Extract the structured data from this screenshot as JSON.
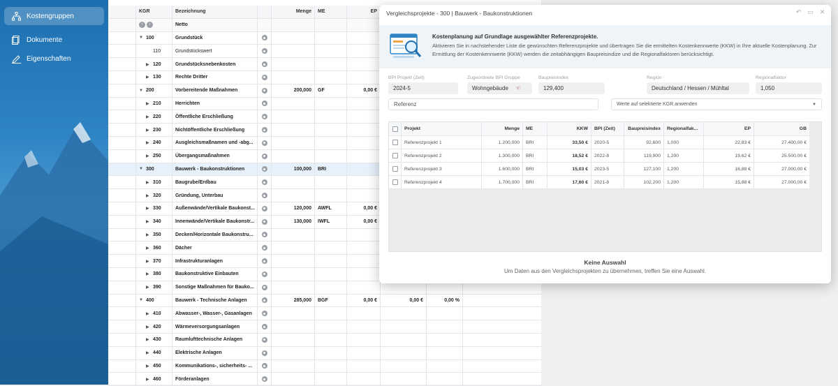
{
  "sidebar": {
    "items": [
      {
        "label": "Kostengruppen",
        "icon": "hierarchy-icon",
        "active": true
      },
      {
        "label": "Dokumente",
        "icon": "document-icon",
        "active": false
      },
      {
        "label": "Eigenschaften",
        "icon": "pencil-icon",
        "active": false
      }
    ]
  },
  "grid": {
    "headers": {
      "kgr": "KGR",
      "bezeichnung": "Bezeichnung",
      "menge": "Menge",
      "me": "ME",
      "ep": "EP"
    },
    "netto_label": "Netto",
    "rows": [
      {
        "expand": "down",
        "kgr": "100",
        "label": "Grundstück",
        "bold": true,
        "menge": "",
        "me": "",
        "ep": "",
        "col8": "",
        "pct": ""
      },
      {
        "expand": "",
        "kgr": "110",
        "label": "Grundstückswert",
        "bold": false,
        "menge": "",
        "me": "",
        "ep": "",
        "col8": "",
        "pct": ""
      },
      {
        "expand": "right",
        "kgr": "120",
        "label": "Grundstücksnebenkosten",
        "bold": true,
        "menge": "",
        "me": "",
        "ep": "",
        "col8": "",
        "pct": ""
      },
      {
        "expand": "right",
        "kgr": "130",
        "label": "Rechte Dritter",
        "bold": true,
        "menge": "",
        "me": "",
        "ep": "",
        "col8": "",
        "pct": ""
      },
      {
        "expand": "down",
        "kgr": "200",
        "label": "Vorbereitende Maßnahmen",
        "bold": true,
        "menge": "200,000",
        "me": "GF",
        "ep": "0,00 €",
        "col8": "",
        "pct": ""
      },
      {
        "expand": "right",
        "kgr": "210",
        "label": "Herrichten",
        "bold": true,
        "menge": "",
        "me": "",
        "ep": "",
        "col8": "",
        "pct": ""
      },
      {
        "expand": "right",
        "kgr": "220",
        "label": "Öffentliche Erschließung",
        "bold": true,
        "menge": "",
        "me": "",
        "ep": "",
        "col8": "",
        "pct": ""
      },
      {
        "expand": "right",
        "kgr": "230",
        "label": "Nichtöffentliche Erschließung",
        "bold": true,
        "menge": "",
        "me": "",
        "ep": "",
        "col8": "",
        "pct": ""
      },
      {
        "expand": "right",
        "kgr": "240",
        "label": "Ausgleichsmaßnamen und -abg...",
        "bold": true,
        "menge": "",
        "me": "",
        "ep": "",
        "col8": "",
        "pct": ""
      },
      {
        "expand": "right",
        "kgr": "250",
        "label": "Übergangsmaßnahmen",
        "bold": true,
        "menge": "",
        "me": "",
        "ep": "",
        "col8": "",
        "pct": ""
      },
      {
        "expand": "down",
        "kgr": "300",
        "label": "Bauwerk - Baukonstruktionen",
        "bold": true,
        "selected": true,
        "menge": "100,000",
        "me": "BRI",
        "ep": "",
        "col8": "",
        "pct": ""
      },
      {
        "expand": "right",
        "kgr": "310",
        "label": "Baugrube/Erdbau",
        "bold": true,
        "menge": "",
        "me": "",
        "ep": "",
        "col8": "",
        "pct": ""
      },
      {
        "expand": "right",
        "kgr": "320",
        "label": "Gründung, Unterbau",
        "bold": true,
        "menge": "",
        "me": "",
        "ep": "",
        "col8": "",
        "pct": ""
      },
      {
        "expand": "right",
        "kgr": "330",
        "label": "Außenwände/Vertikale Baukonst...",
        "bold": true,
        "menge": "120,000",
        "me": "AWFL",
        "ep": "0,00 €",
        "col8": "",
        "pct": ""
      },
      {
        "expand": "right",
        "kgr": "340",
        "label": "Innenwände/Vertikale Baukonstr...",
        "bold": true,
        "menge": "130,000",
        "me": "IWFL",
        "ep": "0,00 €",
        "col8": "",
        "pct": ""
      },
      {
        "expand": "right",
        "kgr": "350",
        "label": "Decken/Horizontale Baukonstru...",
        "bold": true,
        "menge": "",
        "me": "",
        "ep": "",
        "col8": "",
        "pct": ""
      },
      {
        "expand": "right",
        "kgr": "360",
        "label": "Dächer",
        "bold": true,
        "menge": "",
        "me": "",
        "ep": "",
        "col8": "",
        "pct": ""
      },
      {
        "expand": "right",
        "kgr": "370",
        "label": "Infrastrukturanlagen",
        "bold": true,
        "menge": "",
        "me": "",
        "ep": "",
        "col8": "",
        "pct": ""
      },
      {
        "expand": "right",
        "kgr": "380",
        "label": "Baukonstruktive Einbauten",
        "bold": true,
        "menge": "",
        "me": "",
        "ep": "",
        "col8": "",
        "pct": ""
      },
      {
        "expand": "right",
        "kgr": "390",
        "label": "Sonstige Maßnahmen für Bauko...",
        "bold": true,
        "menge": "",
        "me": "",
        "ep": "",
        "col8": "",
        "pct": ""
      },
      {
        "expand": "down",
        "kgr": "400",
        "label": "Bauwerk - Technische Anlagen",
        "bold": true,
        "menge": "285,000",
        "me": "BGF",
        "ep": "0,00 €",
        "col8": "0,00 €",
        "pct": "0,00 %"
      },
      {
        "expand": "right",
        "kgr": "410",
        "label": "Abwasser-, Wasser-, Gasanlagen",
        "bold": true,
        "menge": "",
        "me": "",
        "ep": "",
        "col8": "",
        "pct": ""
      },
      {
        "expand": "right",
        "kgr": "420",
        "label": "Wärmeversorgungsanlagen",
        "bold": true,
        "menge": "",
        "me": "",
        "ep": "",
        "col8": "",
        "pct": ""
      },
      {
        "expand": "right",
        "kgr": "430",
        "label": "Raumlufttechnische Anlagen",
        "bold": true,
        "menge": "",
        "me": "",
        "ep": "",
        "col8": "",
        "pct": ""
      },
      {
        "expand": "right",
        "kgr": "440",
        "label": "Elektrische Anlagen",
        "bold": true,
        "menge": "",
        "me": "",
        "ep": "",
        "col8": "",
        "pct": ""
      },
      {
        "expand": "right",
        "kgr": "450",
        "label": "Kommunikations-, sicherheits- ...",
        "bold": true,
        "menge": "",
        "me": "",
        "ep": "",
        "col8": "",
        "pct": ""
      },
      {
        "expand": "right",
        "kgr": "460",
        "label": "Förderanlagen",
        "bold": true,
        "menge": "",
        "me": "",
        "ep": "",
        "col8": "",
        "pct": ""
      }
    ]
  },
  "dialog": {
    "title": "Vergleichsprojekte - 300 | Bauwerk - Baukonstruktionen",
    "info_title": "Kostenplanung auf Grundlage ausgewählter Referenzprojekte.",
    "info_text": "Aktivieren Sie in nachstehender Liste die gewünschten Referenzprojekte und übertragen Sie die ermittelten Kostenkennwerte (KKW) in Ihre aktuelle Kostenplanung. Zur Ermittlung der Kostenkennwerte (KKW) werden die zeitabhängigen Baupreisindize und die Regionalfaktoren berücksichtigt.",
    "fields": {
      "bpi_projekt_label": "BPI Projekt (Zeit)",
      "bpi_projekt_value": "2024-5",
      "bpi_gruppe_label": "Zugeordnete BPI Gruppe",
      "bpi_gruppe_value": "Wohngebäude",
      "baupreisindex_label": "Baupreisindex",
      "baupreisindex_value": "129,400",
      "region_label": "Region",
      "region_value": "Deutschland / Hessen / Mühltal",
      "regionalfaktor_label": "Regionalfaktor",
      "regionalfaktor_value": "1,050"
    },
    "referenz_placeholder": "Referenz",
    "apply_select": "Werte auf selektierte KGR anwenden",
    "table": {
      "headers": {
        "projekt": "Projekt",
        "menge": "Menge",
        "me": "ME",
        "kkw": "KKW",
        "bpi": "BPI (Zeit)",
        "baupreisindex": "Baupreisindex",
        "regionalfaktor": "Regionalfak...",
        "ep": "EP",
        "gb": "GB"
      },
      "rows": [
        {
          "projekt": "Referenzprojekt 1",
          "menge": "1.200,000",
          "me": "BRI",
          "kkw": "33,50 €",
          "bpi": "2020-5",
          "baupreisindex": "92,600",
          "regionalfaktor": "1,000",
          "ep": "22,83 €",
          "gb": "27.400,00 €"
        },
        {
          "projekt": "Referenzprojekt 2",
          "menge": "1.300,000",
          "me": "BRI",
          "kkw": "18,52 €",
          "bpi": "2022-8",
          "baupreisindex": "119,900",
          "regionalfaktor": "1,200",
          "ep": "19,62 €",
          "gb": "25.500,00 €"
        },
        {
          "projekt": "Referenzprojekt 3",
          "menge": "1.600,000",
          "me": "BRI",
          "kkw": "15,03 €",
          "bpi": "2023-5",
          "baupreisindex": "127,100",
          "regionalfaktor": "1,200",
          "ep": "16,88 €",
          "gb": "27.000,00 €"
        },
        {
          "projekt": "Referenzprojekt 4",
          "menge": "1.700,000",
          "me": "BRI",
          "kkw": "17,60 €",
          "bpi": "2021-8",
          "baupreisindex": "102,200",
          "regionalfaktor": "1,200",
          "ep": "15,88 €",
          "gb": "27.000,00 €"
        }
      ]
    },
    "empty_title": "Keine Auswahl",
    "empty_text": "Um Daten aus den Vergleichsprojekten zu übernehmen, treffen Sie eine Auswahl."
  }
}
